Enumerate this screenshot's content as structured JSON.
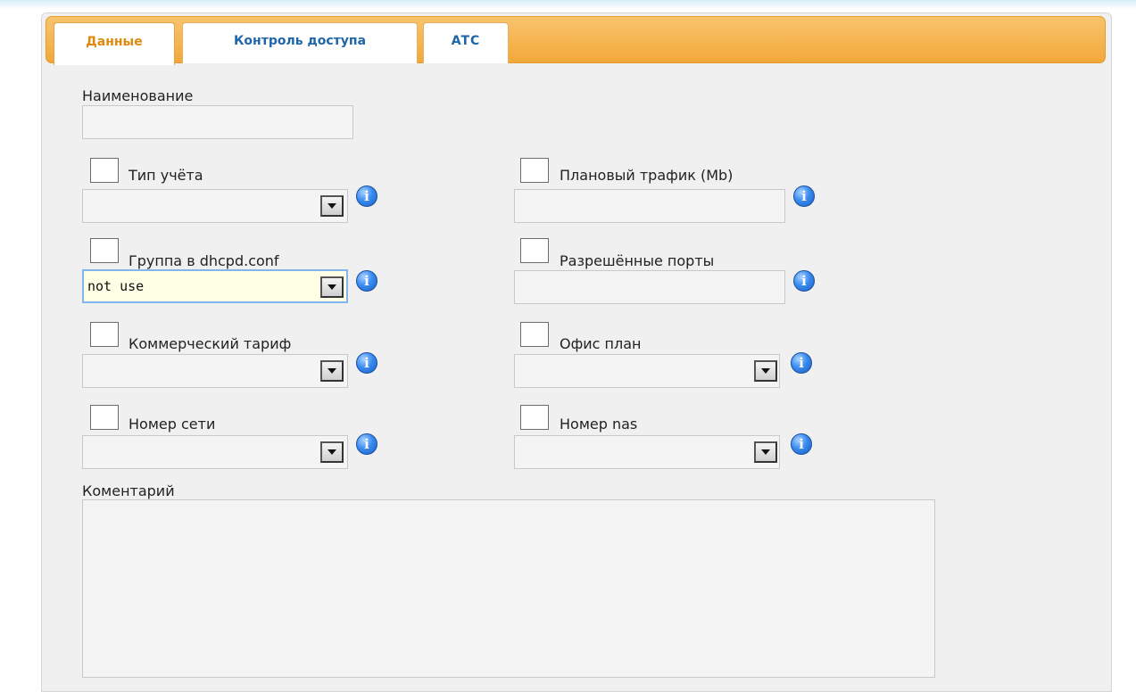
{
  "tabs": {
    "data": "Данные",
    "access": "Контроль доступа",
    "atc": "ATC"
  },
  "form": {
    "name_label": "Наименование",
    "account_type_label": "Тип учёта",
    "planned_traffic_label": "Плановый трафик (Mb)",
    "dhcp_group_label": "Группа в dhcpd.conf",
    "dhcp_group_value": "not use",
    "allowed_ports_label": "Разрешённые порты",
    "commercial_tariff_label": "Коммерческий тариф",
    "office_plan_label": "Офис план",
    "network_number_label": "Номер сети",
    "nas_number_label": "Номер nas",
    "comment_label": "Коментарий"
  },
  "icons": {
    "info": "info-icon",
    "dropdown": "chevron-down-icon"
  },
  "colors": {
    "tabbar_orange": "#f2a83a",
    "active_tab_text": "#e0890f",
    "tab_text": "#1f66a8",
    "focused_field_bg": "#ffffe6",
    "info_blue": "#3a8cf0"
  }
}
